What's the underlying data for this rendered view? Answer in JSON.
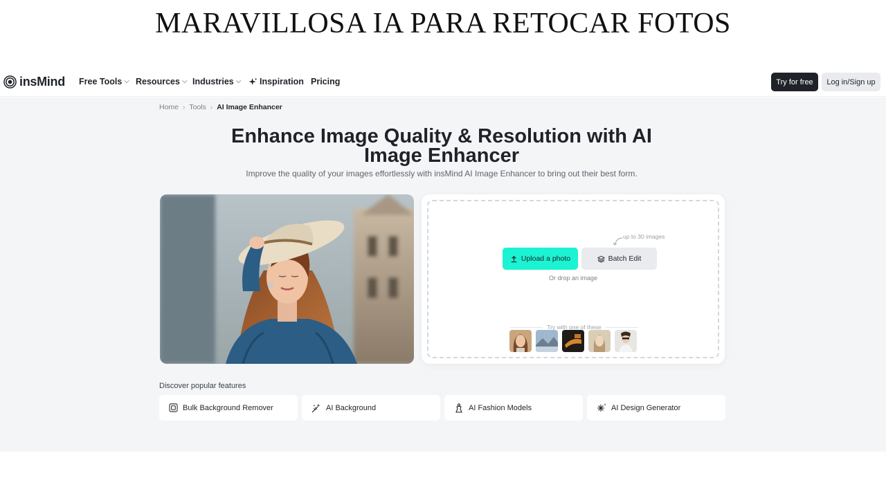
{
  "banner": {
    "title": "MARAVILLOSA IA PARA RETOCAR FOTOS"
  },
  "nav": {
    "logo_text": "insMind",
    "items": [
      {
        "label": "Free Tools",
        "dropdown": true
      },
      {
        "label": "Resources",
        "dropdown": true
      },
      {
        "label": "Industries",
        "dropdown": true
      },
      {
        "label": "Inspiration",
        "dropdown": false
      },
      {
        "label": "Pricing",
        "dropdown": false
      }
    ],
    "try_label": "Try for free",
    "login_label": "Log in/Sign up"
  },
  "breadcrumb": {
    "home": "Home",
    "tools": "Tools",
    "current": "AI Image Enhancer"
  },
  "hero": {
    "title": "Enhance Image Quality & Resolution with AI Image Enhancer",
    "subtitle": "Improve the quality of your images effortlessly with insMind AI Image Enhancer to bring out their best form."
  },
  "upload": {
    "limit_hint": "up to 30 images",
    "upload_label": "Upload a photo",
    "batch_label": "Batch Edit",
    "drop_text": "Or drop an image",
    "samples_label": "Try with one of these"
  },
  "discover": {
    "heading": "Discover popular features",
    "features": [
      {
        "label": "Bulk Background Remover",
        "icon": "bulk-remove-icon"
      },
      {
        "label": "AI Background",
        "icon": "magic-wand-icon"
      },
      {
        "label": "AI Fashion Models",
        "icon": "fashion-model-icon"
      },
      {
        "label": "AI Design Generator",
        "icon": "sparkle-icon"
      }
    ]
  },
  "colors": {
    "accent": "#1bf3d2",
    "dark": "#1f2329",
    "page_bg": "#f4f5f7"
  }
}
